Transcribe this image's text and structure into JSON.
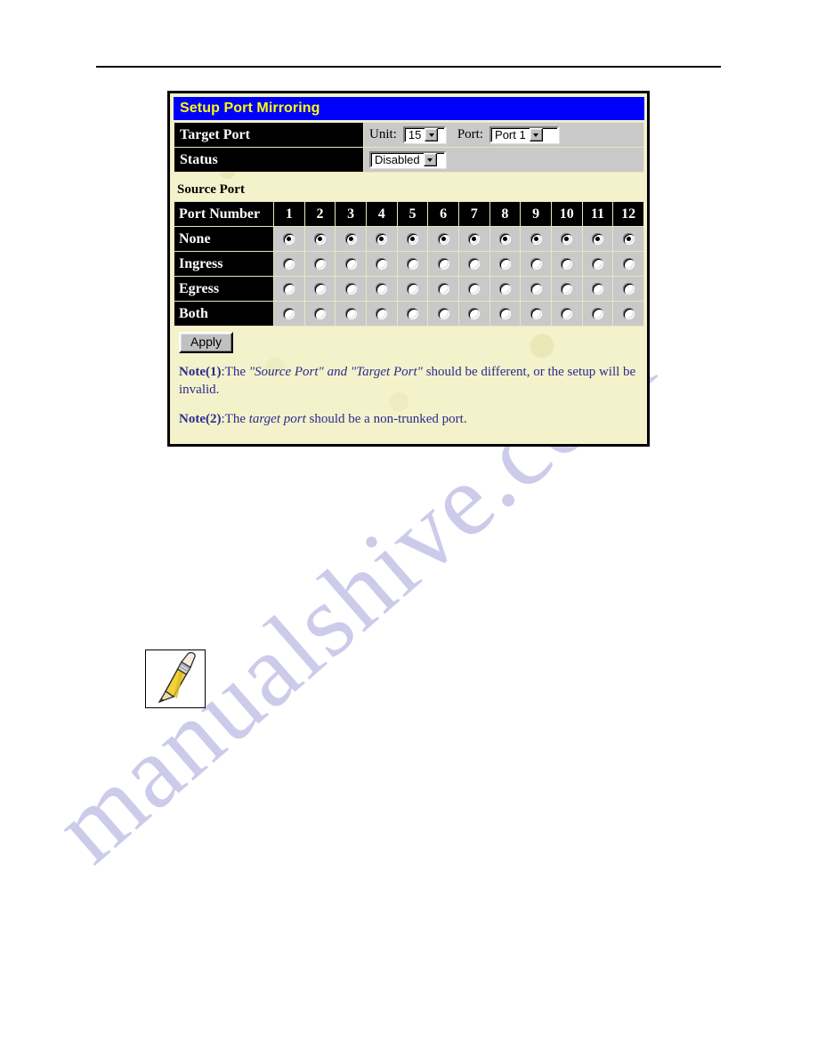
{
  "page": {
    "watermark_text": "manualshive.com"
  },
  "panel": {
    "title": "Setup Port Mirroring",
    "target_port": {
      "label": "Target Port",
      "unit_label": "Unit:",
      "unit_value": "15",
      "port_label": "Port:",
      "port_value": "Port 1"
    },
    "status": {
      "label": "Status",
      "value": "Disabled"
    },
    "source_port": {
      "section_label": "Source Port",
      "header_label": "Port Number",
      "port_numbers": [
        "1",
        "2",
        "3",
        "4",
        "5",
        "6",
        "7",
        "8",
        "9",
        "10",
        "11",
        "12"
      ],
      "rows": [
        {
          "label": "None",
          "selected": [
            true,
            true,
            true,
            true,
            true,
            true,
            true,
            true,
            true,
            true,
            true,
            true
          ]
        },
        {
          "label": "Ingress",
          "selected": [
            false,
            false,
            false,
            false,
            false,
            false,
            false,
            false,
            false,
            false,
            false,
            false
          ]
        },
        {
          "label": "Egress",
          "selected": [
            false,
            false,
            false,
            false,
            false,
            false,
            false,
            false,
            false,
            false,
            false,
            false
          ]
        },
        {
          "label": "Both",
          "selected": [
            false,
            false,
            false,
            false,
            false,
            false,
            false,
            false,
            false,
            false,
            false,
            false
          ]
        }
      ]
    },
    "apply_label": "Apply",
    "notes": [
      {
        "parts": [
          {
            "text": "Note(1)",
            "style": "bold"
          },
          {
            "text": ":The ",
            "style": "normal"
          },
          {
            "text": "\"Source Port\" and \"Target Port\"",
            "style": "italic"
          },
          {
            "text": " should be different, or the setup will be invalid.",
            "style": "normal"
          }
        ]
      },
      {
        "parts": [
          {
            "text": "Note(2)",
            "style": "bold"
          },
          {
            "text": ":The ",
            "style": "normal"
          },
          {
            "text": "target port",
            "style": "italic"
          },
          {
            "text": " should be a non-trunked port.",
            "style": "normal"
          }
        ]
      }
    ]
  },
  "colors": {
    "title_bar": "#0000ff",
    "title_text": "#ffff00",
    "panel_bg": "#f4f2cb",
    "header_cell": "#000000",
    "value_cell": "#c9c9c9",
    "note_text": "#2b2b8f",
    "watermark": "#b9b8e2"
  }
}
